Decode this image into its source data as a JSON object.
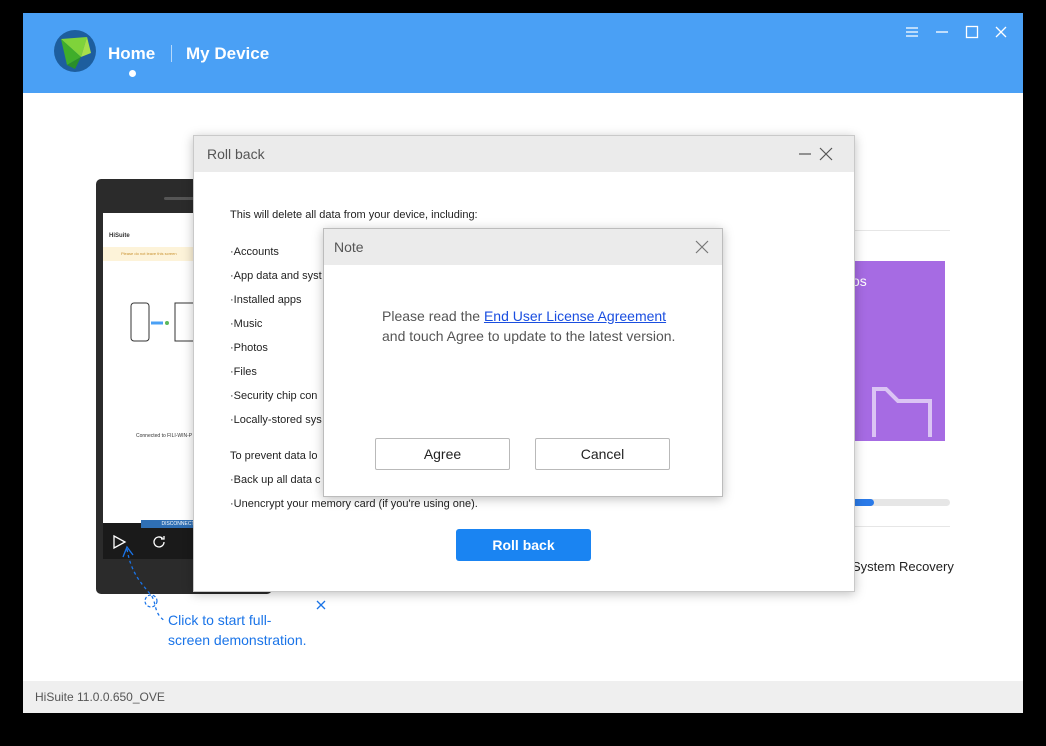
{
  "header": {
    "nav": [
      {
        "label": "Home",
        "active": true
      },
      {
        "label": "My Device",
        "active": false
      }
    ]
  },
  "phone_preview": {
    "app_title": "HiSuite",
    "warning": "Please do not leave this screen",
    "connected": "Connected to FILI-WIN-P",
    "disconnect": "DISCONNECT"
  },
  "demo_hint": "Click to start full-screen demonstration.",
  "background_panel": {
    "card_text": "os",
    "progress_fraction": 0.22,
    "system_recovery": "System Recovery"
  },
  "status_bar": {
    "version": "HiSuite 11.0.0.650_OVE"
  },
  "rollback_dialog": {
    "title": "Roll back",
    "intro": "This will delete all data from your device, including:",
    "items": [
      "·Accounts",
      "·App data and syst",
      "·Installed apps",
      "·Music",
      "·Photos",
      "·Files",
      "·Security chip con",
      "·Locally-stored sys"
    ],
    "prevent_text": "To prevent data lo",
    "steps": [
      "·Back up all data c",
      "·Unencrypt your memory card (if you're using one)."
    ],
    "button": "Roll back"
  },
  "note_dialog": {
    "title": "Note",
    "text_before": "Please read the ",
    "link": "End User License Agreement",
    "text_after": " and touch Agree to update to the latest version.",
    "agree": "Agree",
    "cancel": "Cancel"
  },
  "colors": {
    "titlebar": "#4aa0f5",
    "primary_button": "#1a84f2",
    "link": "#1a4ee0",
    "card_purple": "#a66be3"
  },
  "icons": {
    "logo": "hisuite-logo-icon",
    "menu": "menu-icon",
    "minimize": "minimize-icon",
    "maximize": "maximize-icon",
    "close": "close-icon"
  }
}
